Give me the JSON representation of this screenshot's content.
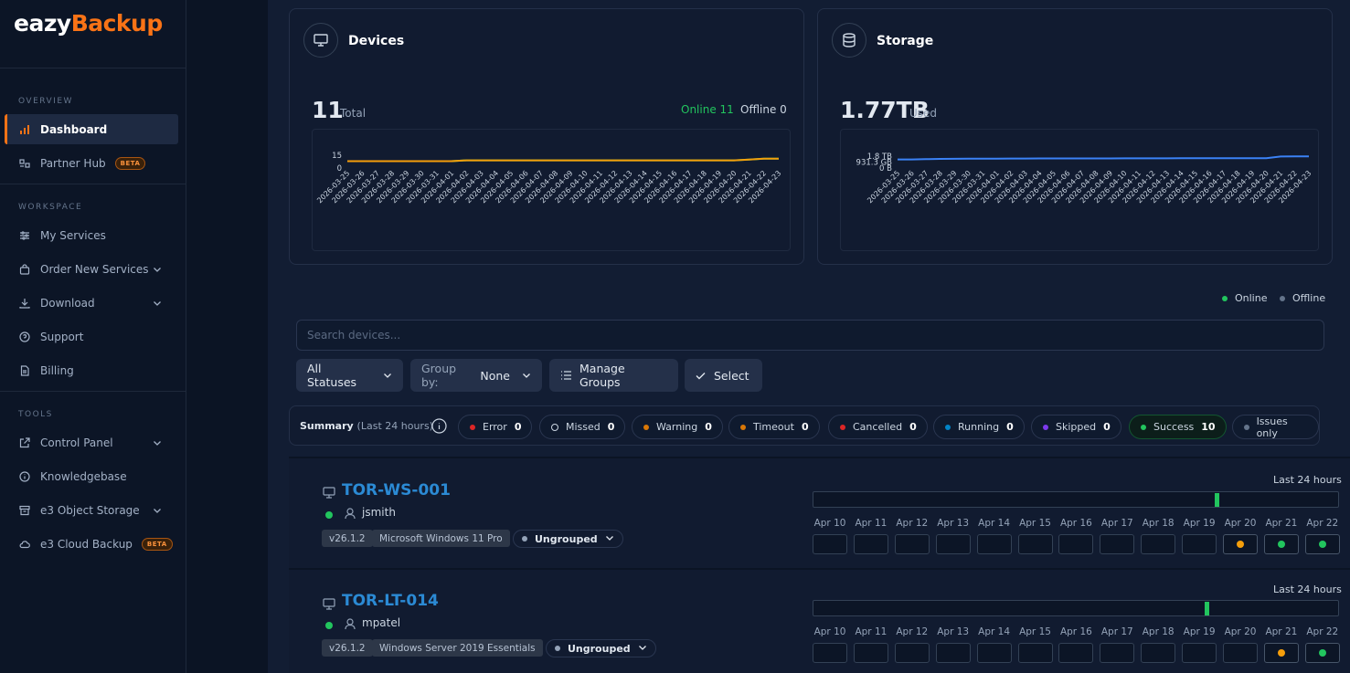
{
  "brand": {
    "part1": "eazy",
    "part2": "Backup"
  },
  "sidebar": {
    "sections": [
      "OVERVIEW",
      "WORKSPACE",
      "TOOLS"
    ],
    "items": [
      {
        "label": "Dashboard",
        "icon": "bar-chart-icon"
      },
      {
        "label": "Partner Hub",
        "icon": "partner-icon",
        "badge": "BETA"
      },
      {
        "label": "My Services",
        "icon": "sliders-icon"
      },
      {
        "label": "Order New Services",
        "icon": "bag-icon"
      },
      {
        "label": "Download",
        "icon": "download-icon"
      },
      {
        "label": "Support",
        "icon": "help-icon"
      },
      {
        "label": "Billing",
        "icon": "file-icon"
      },
      {
        "label": "Control Panel",
        "icon": "external-icon"
      },
      {
        "label": "Knowledgebase",
        "icon": "info-icon"
      },
      {
        "label": "e3 Object Storage",
        "icon": "storage-icon"
      },
      {
        "label": "e3 Cloud Backup",
        "icon": "cloud-icon",
        "badge": "BETA"
      }
    ]
  },
  "devices_card": {
    "title": "Devices",
    "total": "11",
    "total_label": "Total",
    "online": "Online 11",
    "offline": "Offline 0"
  },
  "storage_card": {
    "title": "Storage",
    "used": "1.77TB",
    "used_label": "Used"
  },
  "chart_data": [
    {
      "type": "line",
      "x": [
        "2026-03-25",
        "2026-03-26",
        "2026-03-27",
        "2026-03-28",
        "2026-03-29",
        "2026-03-30",
        "2026-03-31",
        "2026-04-01",
        "2026-04-02",
        "2026-04-03",
        "2026-04-04",
        "2026-04-05",
        "2026-04-06",
        "2026-04-07",
        "2026-04-08",
        "2026-04-09",
        "2026-04-10",
        "2026-04-11",
        "2026-04-12",
        "2026-04-13",
        "2026-04-14",
        "2026-04-15",
        "2026-04-16",
        "2026-04-17",
        "2026-04-18",
        "2026-04-19",
        "2026-04-20",
        "2026-04-21",
        "2026-04-22",
        "2026-04-23"
      ],
      "yticks": [
        "15",
        "0"
      ],
      "ylim": [
        0,
        15
      ],
      "series": [
        {
          "values": [
            8,
            8,
            8,
            8,
            8,
            8,
            8,
            8,
            9,
            9,
            9,
            9,
            9,
            9,
            9,
            9,
            9,
            9,
            9,
            9,
            9,
            9,
            9,
            9,
            9,
            9,
            9,
            10,
            11,
            11
          ],
          "color": "#22c55e"
        },
        {
          "values": [
            8,
            8,
            8,
            8,
            8,
            8,
            8,
            8,
            9,
            9,
            9,
            9,
            9,
            9,
            9,
            9,
            9,
            9,
            9,
            9,
            9,
            9,
            9,
            9,
            9,
            9,
            9,
            10,
            11,
            11
          ],
          "color": "#f59e0b"
        }
      ]
    },
    {
      "type": "line",
      "x": [
        "2026-03-25",
        "2026-03-26",
        "2026-03-27",
        "2026-03-28",
        "2026-03-29",
        "2026-03-30",
        "2026-03-31",
        "2026-04-01",
        "2026-04-02",
        "2026-04-03",
        "2026-04-04",
        "2026-04-05",
        "2026-04-06",
        "2026-04-07",
        "2026-04-08",
        "2026-04-09",
        "2026-04-10",
        "2026-04-11",
        "2026-04-12",
        "2026-04-13",
        "2026-04-14",
        "2026-04-15",
        "2026-04-16",
        "2026-04-17",
        "2026-04-18",
        "2026-04-19",
        "2026-04-20",
        "2026-04-21",
        "2026-04-22",
        "2026-04-23"
      ],
      "yticks": [
        "1.8 TB",
        "931.3 GB",
        "0 B"
      ],
      "ylim": [
        0,
        1.8
      ],
      "series": [
        {
          "values": [
            1.3,
            1.3,
            1.35,
            1.38,
            1.4,
            1.42,
            1.42,
            1.43,
            1.44,
            1.44,
            1.45,
            1.45,
            1.45,
            1.45,
            1.46,
            1.46,
            1.47,
            1.47,
            1.47,
            1.47,
            1.48,
            1.48,
            1.48,
            1.49,
            1.49,
            1.5,
            1.5,
            1.75,
            1.77,
            1.77
          ],
          "color": "#3b82f6"
        }
      ]
    }
  ],
  "legend": {
    "online": "Online",
    "offline": "Offline"
  },
  "search": {
    "placeholder": "Search devices..."
  },
  "toolbar": {
    "status": "All Statuses",
    "groupby_label": "Group by:",
    "groupby_value": "None",
    "manage": "Manage Groups",
    "select": "Select"
  },
  "summary": {
    "label": "Summary",
    "period": "(Last 24 hours)",
    "pills": [
      {
        "label": "Error",
        "count": "0",
        "color": "#dc2626"
      },
      {
        "label": "Missed",
        "count": "0",
        "color": "ring"
      },
      {
        "label": "Warning",
        "count": "0",
        "color": "#d97706"
      },
      {
        "label": "Timeout",
        "count": "0",
        "color": "#d97706"
      },
      {
        "label": "Cancelled",
        "count": "0",
        "color": "#dc2626"
      },
      {
        "label": "Running",
        "count": "0",
        "color": "#0284c7"
      },
      {
        "label": "Skipped",
        "count": "0",
        "color": "#7c3aed"
      },
      {
        "label": "Success",
        "count": "10",
        "color": "#22c55e"
      },
      {
        "label": "Issues only",
        "count": "",
        "color": "#64748b"
      }
    ]
  },
  "days": [
    "Apr 10",
    "Apr 11",
    "Apr 12",
    "Apr 13",
    "Apr 14",
    "Apr 15",
    "Apr 16",
    "Apr 17",
    "Apr 18",
    "Apr 19",
    "Apr 20",
    "Apr 21",
    "Apr 22"
  ],
  "devices": [
    {
      "name": "TOR-WS-001",
      "user": "jsmith",
      "version": "v26.1.2",
      "os": "Microsoft Windows 11 Pro",
      "group": "Ungrouped",
      "last24": "Last 24 hours",
      "marker_pct": 0.77,
      "statuses": [
        "",
        "",
        "",
        "",
        "",
        "",
        "",
        "",
        "",
        "",
        "#f59e0b",
        "#22c55e",
        "#22c55e"
      ]
    },
    {
      "name": "TOR-LT-014",
      "user": "mpatel",
      "version": "v26.1.2",
      "os": "Windows Server 2019 Essentials",
      "group": "Ungrouped",
      "last24": "Last 24 hours",
      "marker_pct": 0.75,
      "statuses": [
        "",
        "",
        "",
        "",
        "",
        "",
        "",
        "",
        "",
        "",
        "",
        "#f59e0b",
        "#22c55e"
      ]
    }
  ]
}
